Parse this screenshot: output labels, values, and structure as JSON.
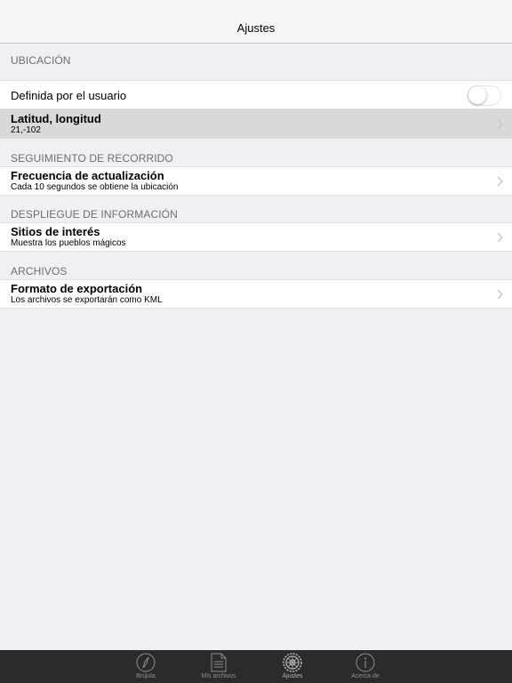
{
  "navbar": {
    "title": "Ajustes"
  },
  "sections": {
    "location": {
      "header": "UBICACIÓN",
      "user_defined_label": "Definida por el usuario",
      "user_defined_on": false,
      "latlon_title": "Latitud, longitud",
      "latlon_value": "21,-102"
    },
    "tracking": {
      "header": "SEGUIMIENTO DE RECORRIDO",
      "frequency_title": "Frecuencia de actualización",
      "frequency_value": "Cada 10 segundos se obtiene la ubicación"
    },
    "display": {
      "header": "DESPLIEGUE DE INFORMACIÓN",
      "sites_title": "Sitios de interés",
      "sites_value": "Muestra los pueblos mágicos"
    },
    "files": {
      "header": "ARCHIVOS",
      "export_title": "Formato de exportación",
      "export_value": "Los archivos se exportarán como KML"
    }
  },
  "tabbar": {
    "tabs": [
      {
        "label": "Brújula",
        "icon": "compass-icon"
      },
      {
        "label": "Mis archivos",
        "icon": "document-icon"
      },
      {
        "label": "Ajustes",
        "icon": "gear-icon"
      },
      {
        "label": "Acerca de",
        "icon": "info-icon"
      }
    ],
    "selected_index": 2
  },
  "colors": {
    "background": "#efeff4",
    "tabbar": "#2b2b2b",
    "selected_cell": "#d9d9d9"
  }
}
